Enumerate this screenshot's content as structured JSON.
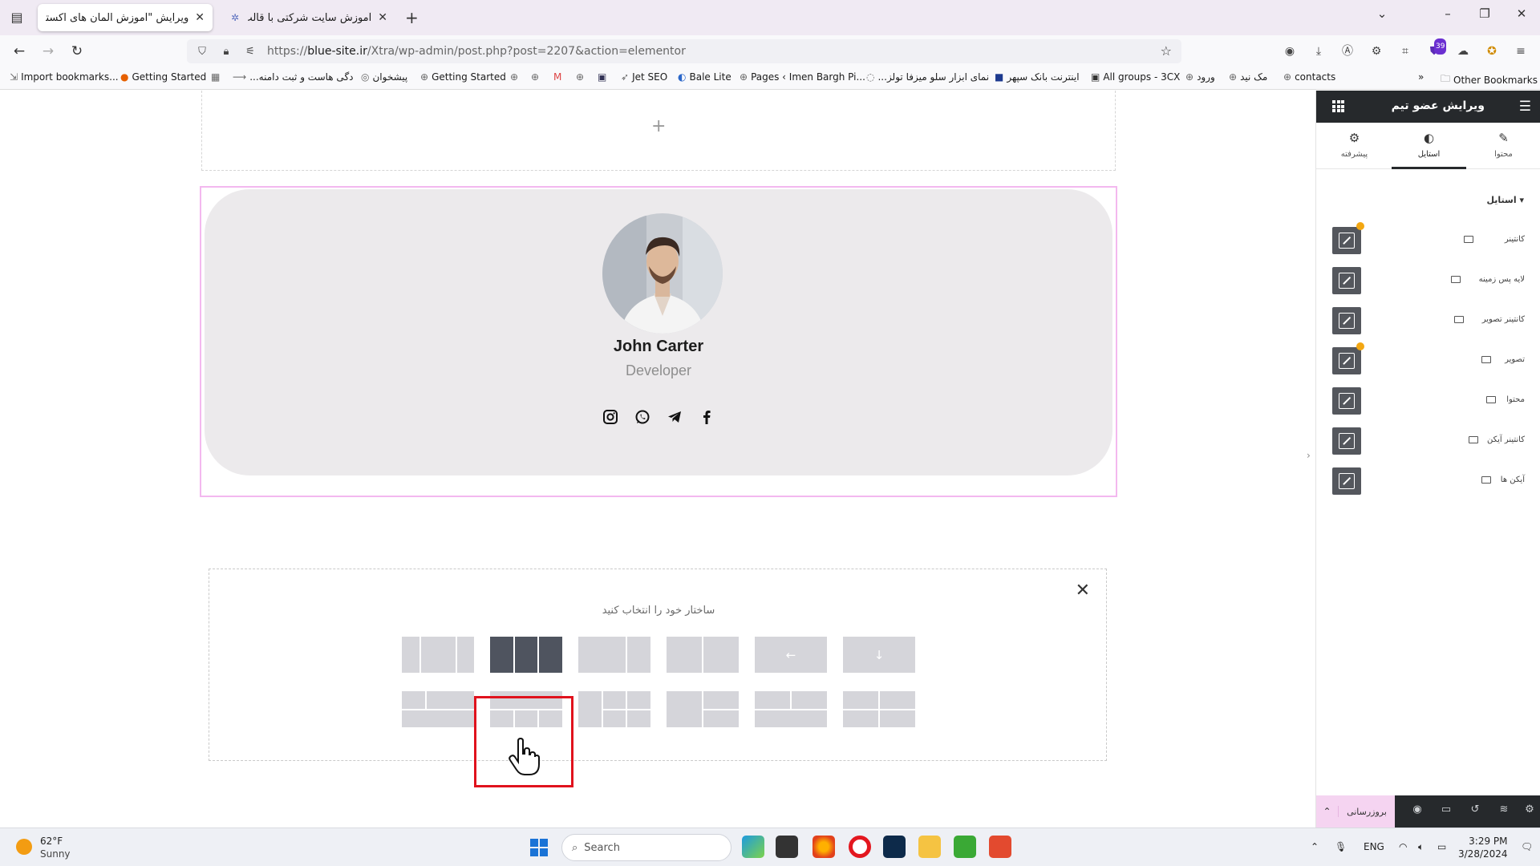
{
  "browser": {
    "tabs": [
      {
        "title": "ویرایش \"آموزش المان های اکسترا – ...",
        "active": true
      },
      {
        "title": "آموزش سایت شرکتی با قالب اکس...",
        "active": false
      }
    ],
    "url_prefix": "https://",
    "url_domain": "blue-site.ir",
    "url_path": "/Xtra/wp-admin/post.php?post=2207&action=elementor",
    "extension_badge": "39",
    "bookmarks": [
      "Import bookmarks...",
      "Getting Started",
      "...دگی هاست و ثبت دامنه",
      "پیشخوان",
      "Getting Started",
      "Jet SEO",
      "Bale Lite",
      "Pages ‹ Imen Bargh Pi...",
      "...نمای ابزار سلو میزفا تولز",
      "اینترنت بانک سپهر",
      "All groups - 3CX",
      "ورود",
      "مک نید",
      "contacts"
    ],
    "other_bookmarks": "Other Bookmarks"
  },
  "canvas": {
    "add_plus": "+",
    "team": {
      "name": "John Carter",
      "role": "Developer",
      "socials": [
        "instagram-icon",
        "whatsapp-icon",
        "telegram-icon",
        "facebook-icon"
      ]
    },
    "structure": {
      "title": "ساختار خود را انتخاب کنید",
      "close": "✕",
      "arrow_left": "←",
      "arrow_down": "↓"
    }
  },
  "panel": {
    "title": "ویرایش عضو تیم",
    "tabs": [
      {
        "label": "محتوا",
        "icon": "pencil-icon"
      },
      {
        "label": "استایل",
        "icon": "half-circle-icon"
      },
      {
        "label": "پیشرفته",
        "icon": "gear-icon"
      }
    ],
    "section_label": "استایل",
    "style_rows": [
      {
        "label": "کانتینر",
        "dot": true
      },
      {
        "label": "لایه پس زمینه",
        "dot": false
      },
      {
        "label": "کانتینر تصویر",
        "dot": false
      },
      {
        "label": "تصویر",
        "dot": true
      },
      {
        "label": "محتوا",
        "dot": false
      },
      {
        "label": "کانتینر آیکن",
        "dot": false
      },
      {
        "label": "آیکن ها",
        "dot": false
      }
    ],
    "publish_label": "بروزرسانی"
  },
  "taskbar": {
    "temp": "62°F",
    "condition": "Sunny",
    "search_placeholder": "Search",
    "lang": "ENG",
    "time": "3:29 PM",
    "date": "3/28/2024"
  },
  "colors": {
    "panel_dark": "#26292c",
    "selected_preset": "#4f545f",
    "highlight_red": "#e0121d",
    "section_border": "#f3b8ef",
    "status_dot": "#f3a712"
  }
}
